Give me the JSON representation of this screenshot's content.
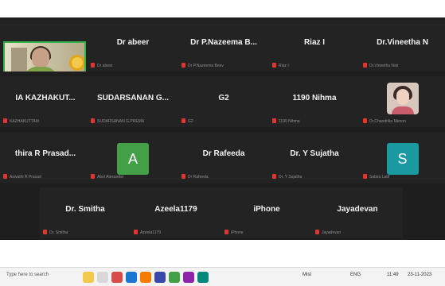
{
  "participants": [
    {
      "name": "",
      "sub": "",
      "type": "video"
    },
    {
      "name": "Dr abeer",
      "sub": "Dr abeer",
      "type": "name"
    },
    {
      "name": "Dr P.Nazeema B...",
      "sub": "Dr P.Nazeema Beev",
      "type": "name"
    },
    {
      "name": "Riaz I",
      "sub": "Riaz I",
      "type": "name"
    },
    {
      "name": "Dr.Vineetha N",
      "sub": "Dr.Vineetha Nair",
      "type": "name"
    },
    {
      "name": "IA KAZHAKUT...",
      "sub": "KAZHAKUTTAM",
      "type": "name"
    },
    {
      "name": "SUDARSANAN G...",
      "sub": "SUDARSANAN G.PREMA",
      "type": "name"
    },
    {
      "name": "G2",
      "sub": "G2",
      "type": "name"
    },
    {
      "name": "1190 Nihma",
      "sub": "1190 Nihma",
      "type": "name"
    },
    {
      "name": "",
      "sub": "Dr.Chandrika Menon",
      "type": "photo"
    },
    {
      "name": "thira R Prasad...",
      "sub": "Aswathi R Prasad",
      "type": "name"
    },
    {
      "name": "",
      "sub": "Abel Alexander",
      "type": "avatar",
      "letter": "A",
      "color": "#43a047"
    },
    {
      "name": "Dr Rafeeda",
      "sub": "Dr Rafeeda",
      "type": "name"
    },
    {
      "name": "Dr. Y Sujatha",
      "sub": "Dr. Y Sujatha",
      "type": "name"
    },
    {
      "name": "",
      "sub": "Sabira Latif",
      "type": "avatar",
      "letter": "S",
      "color": "#1a9aa0"
    },
    {
      "name": "Dr. Smitha",
      "sub": "Dr. Smitha",
      "type": "name"
    },
    {
      "name": "Azeela1179",
      "sub": "Azeela1179",
      "type": "name"
    },
    {
      "name": "iPhone",
      "sub": "iPhone",
      "type": "name"
    },
    {
      "name": "Jayadevan",
      "sub": "Jayadevan",
      "type": "name"
    }
  ],
  "taskbar": {
    "search_placeholder": "Type here to search",
    "weather": "Mist",
    "time": "11:49",
    "date": "23-11-2023",
    "lang": "ENG"
  }
}
